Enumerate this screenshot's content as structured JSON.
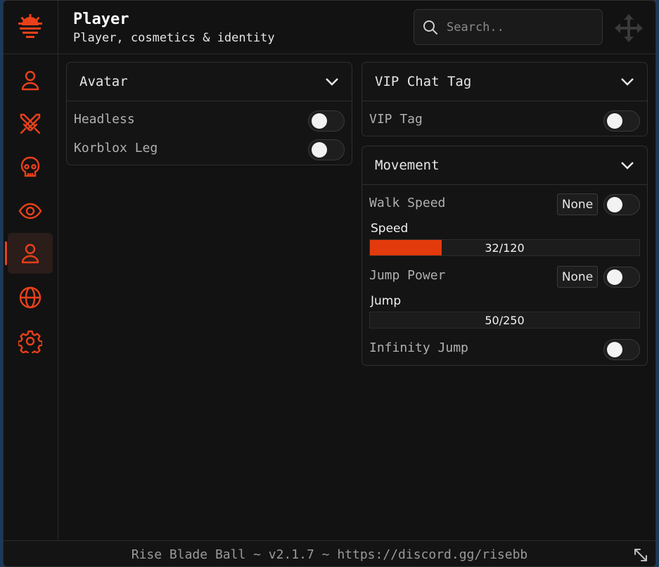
{
  "colors": {
    "accent": "#e8401a",
    "panel_bg": "#141414",
    "window_bg": "#121212"
  },
  "header": {
    "title": "Player",
    "subtitle": "Player, cosmetics & identity",
    "search_placeholder": "Search.."
  },
  "sidebar": {
    "items": [
      {
        "icon": "user-icon",
        "active": false
      },
      {
        "icon": "crossed-swords-icon",
        "active": false
      },
      {
        "icon": "skull-icon",
        "active": false
      },
      {
        "icon": "eye-icon",
        "active": false
      },
      {
        "icon": "user-icon",
        "active": true
      },
      {
        "icon": "globe-icon",
        "active": false
      },
      {
        "icon": "gear-icon",
        "active": false
      }
    ]
  },
  "panels": {
    "avatar": {
      "title": "Avatar",
      "rows": [
        {
          "label": "Headless",
          "enabled": false
        },
        {
          "label": "Korblox Leg",
          "enabled": false
        }
      ]
    },
    "vip": {
      "title": "VIP Chat Tag",
      "rows": [
        {
          "label": "VIP Tag",
          "enabled": false
        }
      ]
    },
    "movement": {
      "title": "Movement",
      "walk_speed": {
        "label": "Walk Speed",
        "keybind": "None",
        "enabled": false
      },
      "speed_slider": {
        "label": "Speed",
        "value_text": "32/120",
        "value": 32,
        "max": 120
      },
      "jump_power": {
        "label": "Jump Power",
        "keybind": "None",
        "enabled": false
      },
      "jump_slider": {
        "label": "Jump",
        "value_text": "50/250",
        "value": 50,
        "max": 250
      },
      "infinity_jump": {
        "label": "Infinity Jump",
        "enabled": false
      }
    }
  },
  "footer": {
    "text": "Rise Blade Ball ~ v2.1.7 ~ https://discord.gg/risebb"
  }
}
